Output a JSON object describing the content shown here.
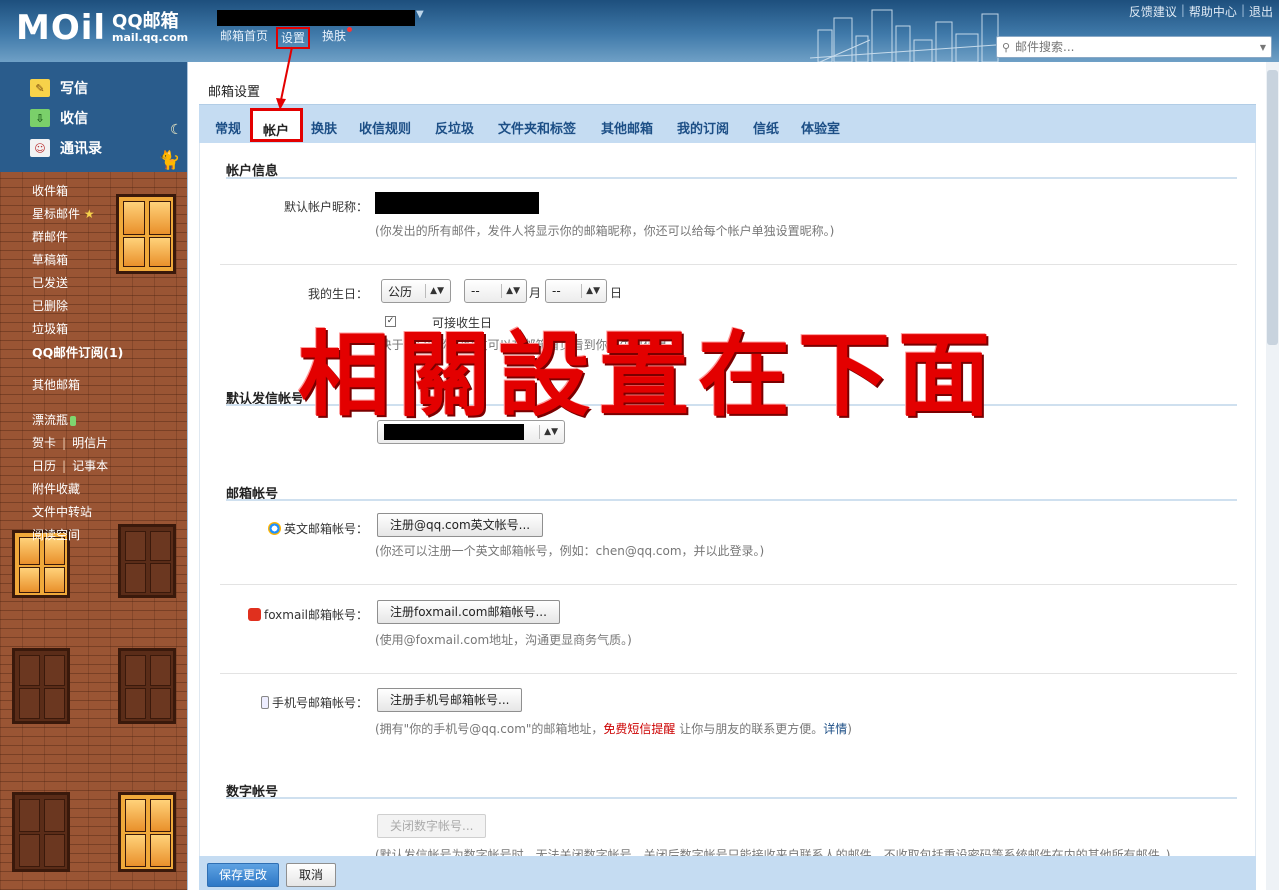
{
  "app": {
    "logo_main": "MOil",
    "logo_cn": "QQ邮箱",
    "logo_url": "mail.qq.com"
  },
  "topnav": {
    "home": "邮箱首页",
    "settings": "设置",
    "skin": "换肤"
  },
  "toplinks": [
    "反馈建议",
    "帮助中心",
    "退出"
  ],
  "search": {
    "placeholder": "邮件搜索..."
  },
  "sidebar": {
    "write": "写信",
    "inbox": "收信",
    "contacts": "通讯录",
    "folders": {
      "inbox": "收件箱",
      "starred": "星标邮件",
      "group": "群邮件",
      "drafts": "草稿箱",
      "sent": "已发送",
      "deleted": "已删除",
      "trash": "垃圾箱",
      "subscriptions": "QQ邮件订阅(1)",
      "other_mail": "其他邮箱",
      "bottle": "漂流瓶",
      "card": "贺卡",
      "postcard": "明信片",
      "calendar": "日历",
      "notes": "记事本",
      "attachments": "附件收藏",
      "file_transfer": "文件中转站",
      "reading": "阅读空间"
    }
  },
  "page": {
    "title": "邮箱设置",
    "tabs": [
      "常规",
      "帐户",
      "换肤",
      "收信规则",
      "反垃圾",
      "文件夹和标签",
      "其他邮箱",
      "我的订阅",
      "信纸",
      "体验室"
    ]
  },
  "account_info": {
    "section_title": "帐户信息",
    "nickname_label": "默认帐户昵称：",
    "nickname_hint": "(你发出的所有邮件，发件人将显示你的邮箱昵称，你还可以给每个帐户单独设置昵称。)"
  },
  "birthday": {
    "label": "我的生日：",
    "calendar_type": "公历",
    "month_value": "--",
    "month_unit": "月",
    "day_value": "--",
    "day_unit": "日",
    "checkbox_label": "可接收生日",
    "hint": "(快于生日时你的好友可以在邮箱首页看到你的生日信息。)"
  },
  "default_sender": {
    "section_title": "默认发信帐号"
  },
  "mail_accounts": {
    "section_title": "邮箱帐号",
    "english_label": "英文邮箱帐号：",
    "english_btn": "注册@qq.com英文帐号...",
    "english_hint": "(你还可以注册一个英文邮箱帐号，例如：chen@qq.com，并以此登录。)",
    "foxmail_label": "foxmail邮箱帐号：",
    "foxmail_btn": "注册foxmail.com邮箱帐号...",
    "foxmail_hint": "(使用@foxmail.com地址，沟通更显商务气质。)",
    "mobile_label": "手机号邮箱帐号：",
    "mobile_btn": "注册手机号邮箱帐号...",
    "mobile_hint_1": "(拥有\"你的手机号@qq.com\"的邮箱地址，",
    "mobile_hint_warn": "免费短信提醒",
    "mobile_hint_2": " 让你与朋友的联系更方便。",
    "mobile_hint_link": "详情",
    "mobile_hint_3": ")"
  },
  "digit_account": {
    "section_title": "数字帐号",
    "close_btn": "关闭数字帐号...",
    "hint": "(默认发信帐号为数字帐号时，无法关闭数字帐号。关闭后数字帐号只能接收来自联系人的邮件，不收取包括重设密码等系统邮件在内的其他所有邮件。)"
  },
  "overlay": {
    "text": "相關設置在下面"
  },
  "footer": {
    "save": "保存更改",
    "cancel": "取消"
  },
  "colors": {
    "accent": "#1d4f86",
    "annotation_red": "#e30000",
    "tab_bar": "#c5dcf2"
  }
}
